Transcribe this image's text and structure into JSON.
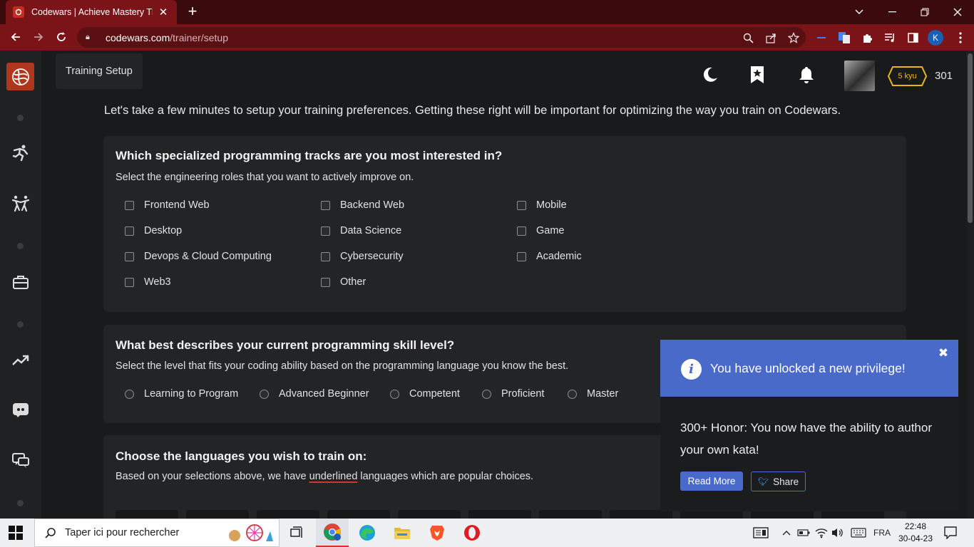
{
  "browser": {
    "tab_title": "Codewars | Achieve Mastery Thro",
    "url_domain": "codewars.com",
    "url_path": "/trainer/setup",
    "profile_initial": "K"
  },
  "header": {
    "tooltip": "Training Setup",
    "kyu": "5 kyu",
    "honor": "301"
  },
  "intro": "Let's take a few minutes to setup your training preferences. Getting these right will be important for optimizing the way you train on Codewars.",
  "tracks": {
    "title": "Which specialized programming tracks are you most interested in?",
    "subtitle": "Select the engineering roles that you want to actively improve on.",
    "options": [
      "Frontend Web",
      "Backend Web",
      "Mobile",
      "Desktop",
      "Data Science",
      "Game",
      "Devops & Cloud Computing",
      "Cybersecurity",
      "Academic",
      "Web3",
      "Other"
    ]
  },
  "skill": {
    "title": "What best describes your current programming skill level?",
    "subtitle": "Select the level that fits your coding ability based on the programming language you know the best.",
    "options": [
      "Learning to Program",
      "Advanced Beginner",
      "Competent",
      "Proficient",
      "Master"
    ]
  },
  "languages": {
    "title": "Choose the languages you wish to train on:",
    "subtitle_pre": "Based on your selections above, we have ",
    "subtitle_underlined": "underlined",
    "subtitle_post": " languages which are popular choices."
  },
  "notification": {
    "title": "You have unlocked a new privilege!",
    "message": "300+ Honor: You now have the ability to author your own kata!",
    "read_more": "Read More",
    "share": "Share"
  },
  "taskbar": {
    "search_placeholder": "Taper ici pour rechercher",
    "language": "FRA",
    "time": "22:48",
    "date": "30-04-23"
  },
  "colors": {
    "brand_red": "#b1361e",
    "chrome_red": "#7a1418",
    "notif_blue": "#4a6ac9",
    "kyu_yellow": "#ecb613"
  }
}
